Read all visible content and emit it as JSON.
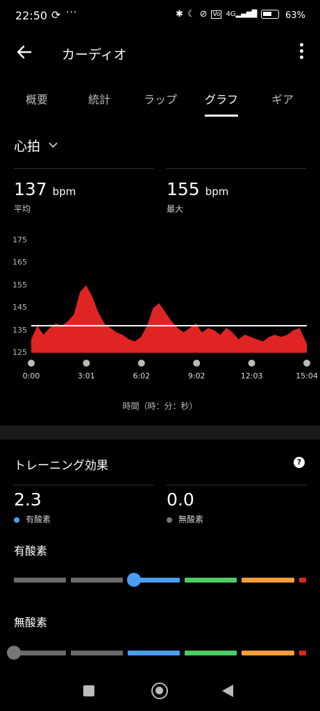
{
  "status_bar": {
    "time": "22:50",
    "sync_icon": "sync-icon",
    "more": "···",
    "battery_percent": "63%"
  },
  "app_bar": {
    "title": "カーディオ",
    "back_icon": "arrow-left-icon",
    "more_icon": "more-vertical-icon"
  },
  "tabs": [
    {
      "label": "概要",
      "active": false
    },
    {
      "label": "統計",
      "active": false
    },
    {
      "label": "ラップ",
      "active": false
    },
    {
      "label": "グラフ",
      "active": true
    },
    {
      "label": "ギア",
      "active": false
    }
  ],
  "metric": {
    "selected": "心拍",
    "dropdown_icon": "chevron-down-icon"
  },
  "stats": {
    "avg_value": "137",
    "avg_unit": "bpm",
    "avg_label": "平均",
    "max_value": "155",
    "max_unit": "bpm",
    "max_label": "最大"
  },
  "chart_data": {
    "type": "area",
    "y_ticks": [
      "175",
      "165",
      "155",
      "145",
      "135",
      "125"
    ],
    "x_ticks": [
      "0:00",
      "3:01",
      "6:02",
      "9:02",
      "12:03",
      "15:04"
    ],
    "ylim": [
      125,
      175
    ],
    "xlabel": "時間（時：分：秒）",
    "average_line": 137,
    "fill_color": "#e02424",
    "series": [
      {
        "x_seconds": [
          0,
          20,
          40,
          60,
          80,
          100,
          120,
          140,
          160,
          180,
          200,
          220,
          240,
          260,
          280,
          300,
          320,
          340,
          360,
          380,
          400,
          420,
          440,
          460,
          480,
          500,
          520,
          540,
          560,
          580,
          600,
          620,
          640,
          660,
          680,
          700,
          720,
          740,
          760,
          780,
          800,
          820,
          840,
          860,
          880,
          904
        ],
        "values": [
          131,
          137,
          133,
          136,
          138,
          137,
          139,
          142,
          152,
          155,
          150,
          143,
          138,
          136,
          134,
          133,
          131,
          130,
          132,
          137,
          145,
          147,
          143,
          139,
          136,
          134,
          136,
          138,
          134,
          136,
          135,
          133,
          136,
          134,
          131,
          133,
          132,
          131,
          130,
          132,
          133,
          132,
          133,
          135,
          136,
          129
        ]
      }
    ]
  },
  "training_effect": {
    "title": "トレーニング効果",
    "help_icon": "help-circle-icon",
    "aerobic_value": "2.3",
    "aerobic_label": "有酸素",
    "anaerobic_value": "0.0",
    "anaerobic_label": "無酸素",
    "aerobic_dot_color": "#4a9ff5",
    "anaerobic_dot_color": "#777777",
    "aerobic_level_fraction": 0.41,
    "anaerobic_level_fraction": 0.0,
    "scale_colors": [
      "#6b6b6b",
      "#6b6b6b",
      "#4a9ff5",
      "#4ccd61",
      "#ff9d3a",
      "#e02424"
    ]
  },
  "nav": {
    "recent_icon": "square-icon",
    "home_icon": "home-circle-icon",
    "back_icon": "triangle-back-icon"
  }
}
